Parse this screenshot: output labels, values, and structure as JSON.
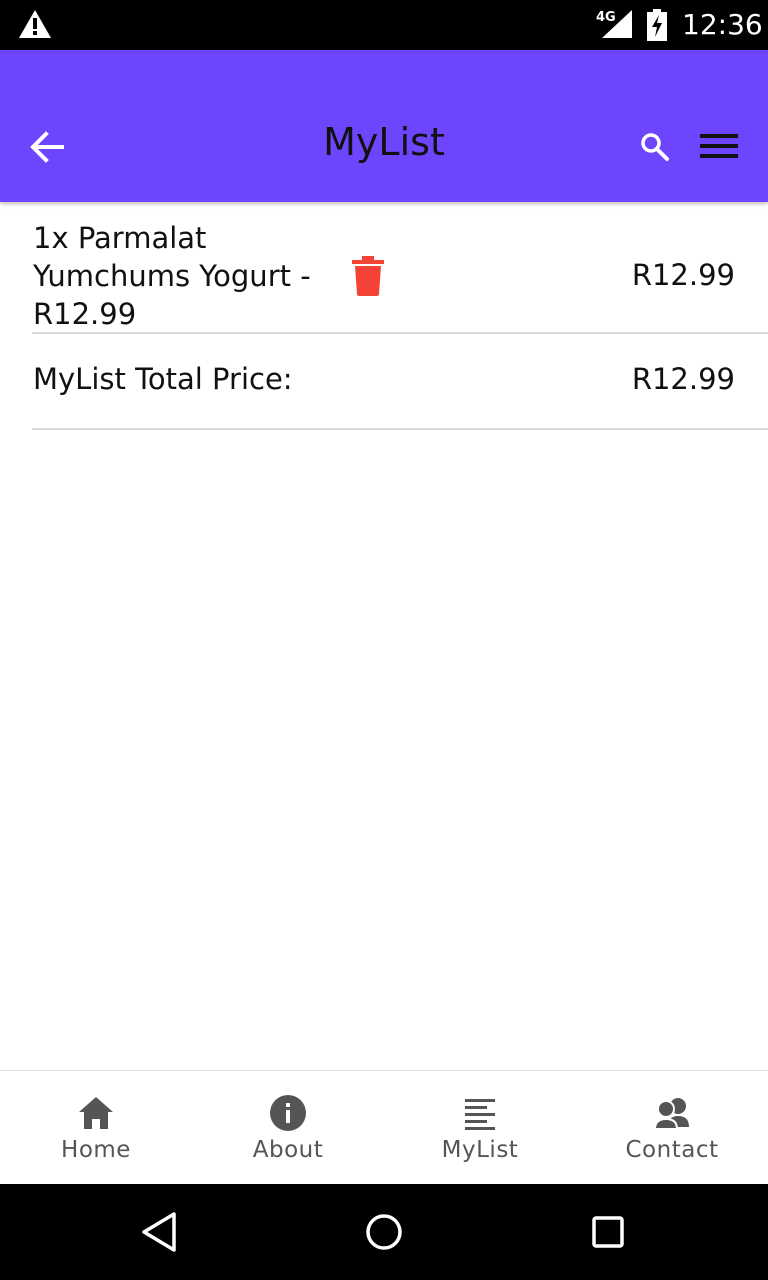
{
  "status_bar": {
    "network": "4G",
    "time": "12:36",
    "icons": [
      "warning-icon",
      "signal-icon",
      "battery-charging-icon"
    ]
  },
  "app_bar": {
    "title": "MyList",
    "color": "#6d45fd",
    "icons": [
      "back-arrow-icon",
      "search-icon",
      "menu-icon"
    ]
  },
  "list": {
    "items": [
      {
        "name": "1x Parmalat Yumchums Yogurt - R12.99",
        "price": "R12.99",
        "delete_icon": "trash-icon",
        "delete_color": "#f44336"
      }
    ],
    "total_label": "MyList Total Price:",
    "total_price": "R12.99"
  },
  "bottom_nav": {
    "items": [
      {
        "label": "Home",
        "icon": "home-icon"
      },
      {
        "label": "About",
        "icon": "info-icon"
      },
      {
        "label": "MyList",
        "icon": "list-icon"
      },
      {
        "label": "Contact",
        "icon": "contacts-icon"
      }
    ]
  },
  "system_nav": {
    "icons": [
      "nav-back-icon",
      "nav-home-icon",
      "nav-recents-icon"
    ]
  }
}
